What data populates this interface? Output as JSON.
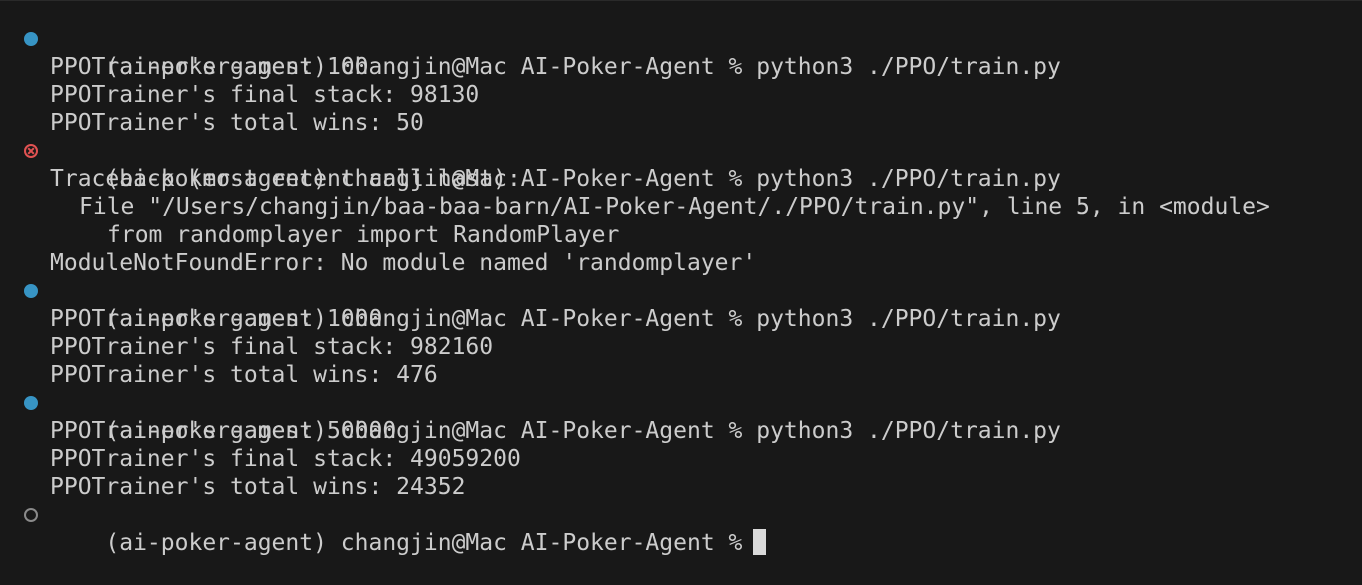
{
  "colors": {
    "background": "#181818",
    "text": "#cccccc",
    "success_marker": "#3794c4",
    "error_marker": "#e15252",
    "default_marker": "#8a8a8a"
  },
  "prompt": "(ai-poker-agent) changjin@Mac AI-Poker-Agent %",
  "lines": [
    {
      "kind": "command",
      "status": "success",
      "command": "python3 ./PPO/train.py"
    },
    {
      "kind": "output",
      "text": "PPOTrainer's games: 100"
    },
    {
      "kind": "output",
      "text": "PPOTrainer's final stack: 98130"
    },
    {
      "kind": "output",
      "text": "PPOTrainer's total wins: 50"
    },
    {
      "kind": "command",
      "status": "error",
      "command": "python3 ./PPO/train.py"
    },
    {
      "kind": "output",
      "text": "Traceback (most recent call last):"
    },
    {
      "kind": "output",
      "text": "File \"/Users/changjin/baa-baa-barn/AI-Poker-Agent/./PPO/train.py\", line 5, in <module>"
    },
    {
      "kind": "output",
      "text": "from randomplayer import RandomPlayer"
    },
    {
      "kind": "output",
      "text": "ModuleNotFoundError: No module named 'randomplayer'"
    },
    {
      "kind": "command",
      "status": "success",
      "command": "python3 ./PPO/train.py"
    },
    {
      "kind": "output",
      "text": "PPOTrainer's games: 1000"
    },
    {
      "kind": "output",
      "text": "PPOTrainer's final stack: 982160"
    },
    {
      "kind": "output",
      "text": "PPOTrainer's total wins: 476"
    },
    {
      "kind": "command",
      "status": "success",
      "command": "python3 ./PPO/train.py"
    },
    {
      "kind": "output",
      "text": "PPOTrainer's games: 50000"
    },
    {
      "kind": "output",
      "text": "PPOTrainer's final stack: 49059200"
    },
    {
      "kind": "output",
      "text": "PPOTrainer's total wins: 24352"
    },
    {
      "kind": "command",
      "status": "default",
      "command": ""
    }
  ]
}
